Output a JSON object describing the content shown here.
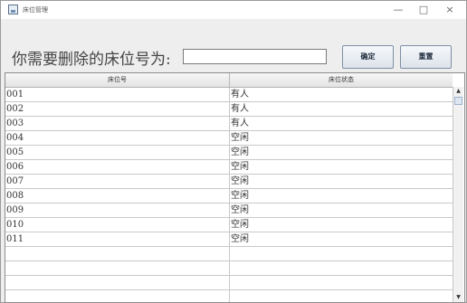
{
  "window": {
    "title": "床位管理",
    "minimize_glyph": "—",
    "maximize_glyph": "□",
    "close_glyph": "×"
  },
  "form": {
    "prompt": "你需要删除的床位号为:",
    "input_value": "",
    "confirm_label": "确定",
    "reset_label": "重置"
  },
  "table": {
    "columns": [
      "床位号",
      "床位状态"
    ],
    "rows": [
      {
        "bed": "001",
        "status": "有人"
      },
      {
        "bed": "002",
        "status": "有人"
      },
      {
        "bed": "003",
        "status": "有人"
      },
      {
        "bed": "004",
        "status": "空闲"
      },
      {
        "bed": "005",
        "status": "空闲"
      },
      {
        "bed": "006",
        "status": "空闲"
      },
      {
        "bed": "007",
        "status": "空闲"
      },
      {
        "bed": "008",
        "status": "空闲"
      },
      {
        "bed": "009",
        "status": "空闲"
      },
      {
        "bed": "010",
        "status": "空闲"
      },
      {
        "bed": "011",
        "status": "空闲"
      },
      {
        "bed": "",
        "status": ""
      },
      {
        "bed": "",
        "status": ""
      },
      {
        "bed": "",
        "status": ""
      },
      {
        "bed": "",
        "status": ""
      }
    ]
  },
  "scrollbar": {
    "up_glyph": "▲",
    "down_glyph": "▼"
  }
}
